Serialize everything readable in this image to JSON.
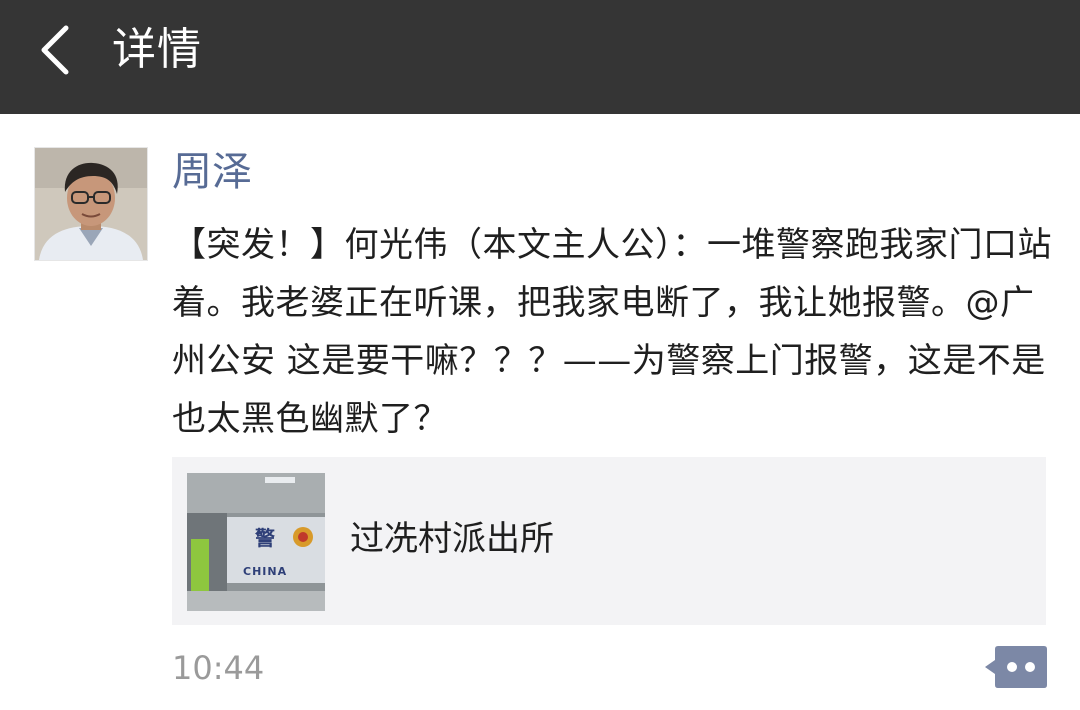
{
  "navbar": {
    "title": "详情",
    "back_icon": "chevron-left-icon"
  },
  "post": {
    "author": "周泽",
    "content": "【突发！】何光伟（本文主人公）：一堆警察跑我家门口站着。我老婆正在听课，把我家电断了，我让她报警。@广州公安 这是要干嘛？？？——为警察上门报警，这是不是也太黑色幽默了？",
    "link": {
      "title": "过冼村派出所",
      "thumbnail_sign_char": "警",
      "thumbnail_sign_text": "CHINA"
    },
    "time": "10:44",
    "comment_icon": "comment-dots-icon"
  },
  "colors": {
    "navbar_bg": "#353535",
    "author": "#576b95",
    "link_card_bg": "#f3f3f5",
    "comment_button": "#7c88a6"
  }
}
